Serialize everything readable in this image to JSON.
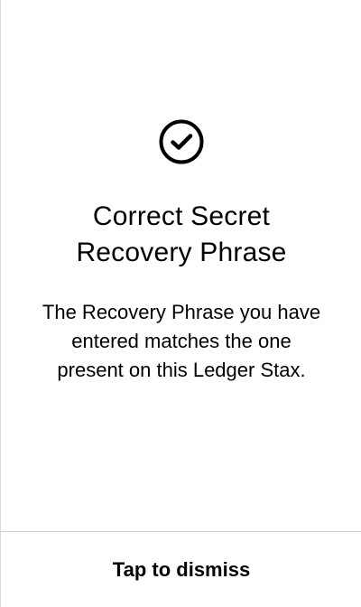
{
  "screen": {
    "status_icon": "check-circle-icon",
    "title_line_1": "Correct Secret",
    "title_line_2": "Recovery Phrase",
    "description_line_1": "The Recovery Phrase you have",
    "description_line_2": "entered matches the one",
    "description_line_3": "present on this Ledger Stax."
  },
  "footer": {
    "dismiss_label": "Tap to dismiss"
  },
  "colors": {
    "background": "#ffffff",
    "text": "#000000",
    "divider": "#cfcfcf"
  }
}
